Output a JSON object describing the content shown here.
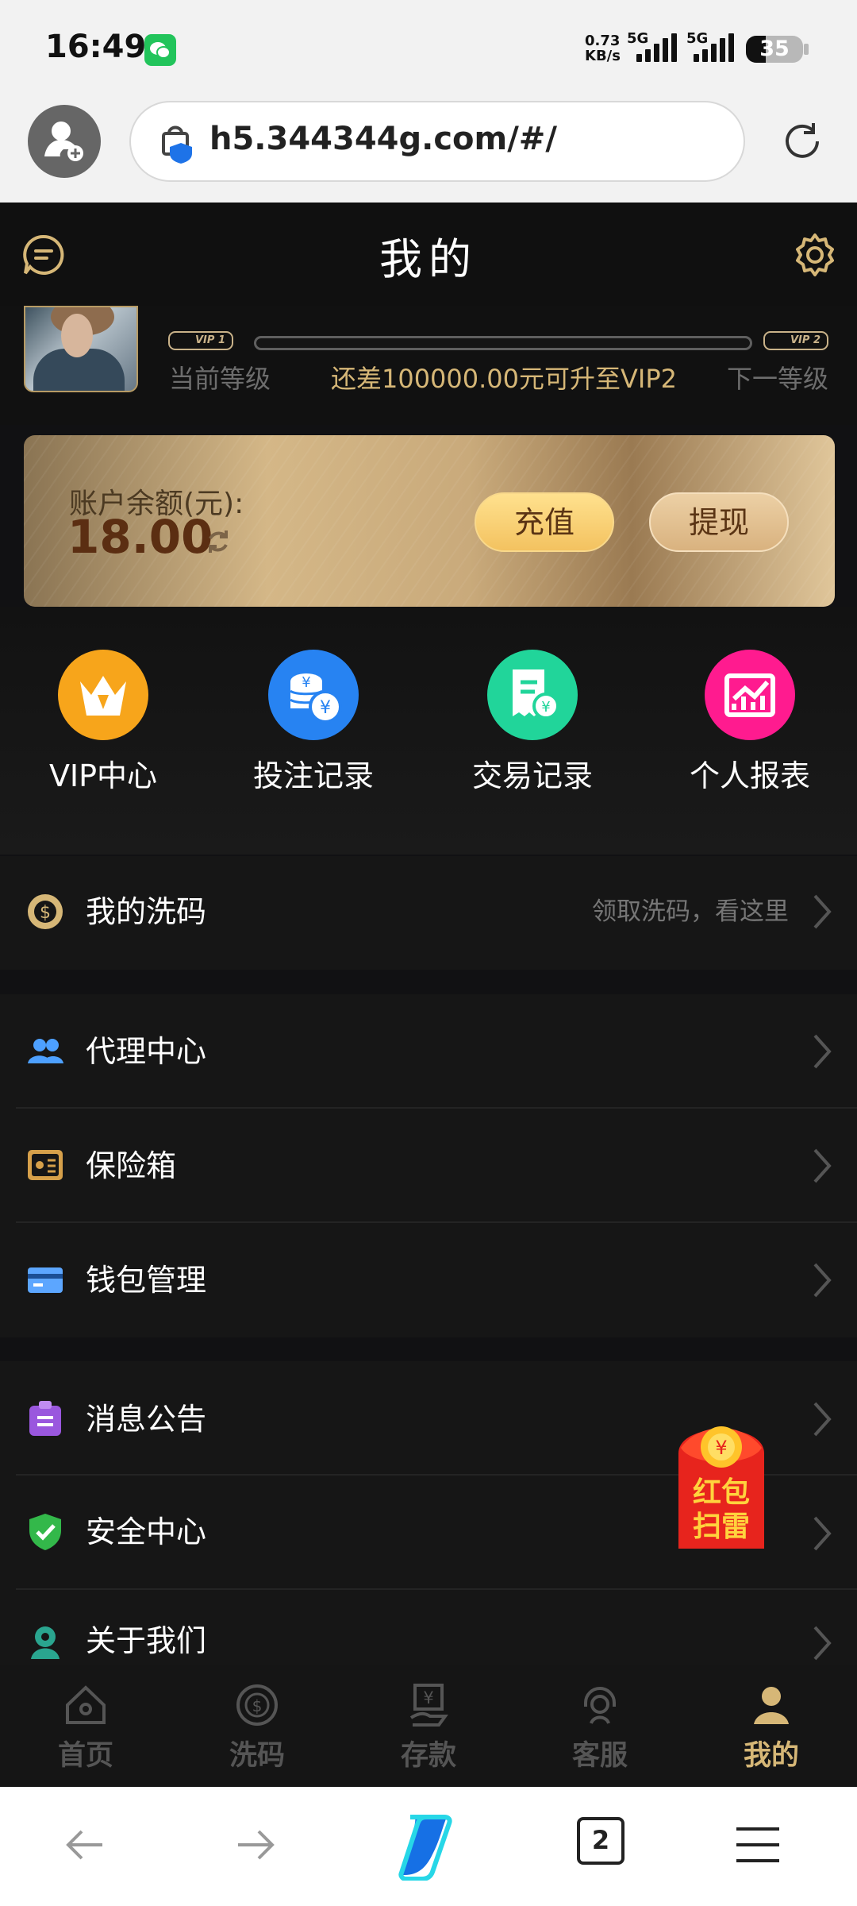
{
  "status_bar": {
    "time": "16:49",
    "network_speed_value": "0.73",
    "network_speed_unit": "KB/s",
    "signal_1": "5G",
    "signal_2": "5G",
    "battery": "35",
    "battery_level": 0.35
  },
  "browser": {
    "url": "h5.344344g.com/#/",
    "tab_count": "2"
  },
  "header": {
    "title": "我的"
  },
  "profile": {
    "current_vip": "VIP 1",
    "next_vip": "VIP 2",
    "current_level_label": "当前等级",
    "upgrade_text": "还差100000.00元可升至VIP2",
    "next_level_label": "下一等级",
    "vip_progress": 0
  },
  "balance": {
    "label": "账户余额(元):",
    "value": "18.00",
    "recharge_label": "充值",
    "withdraw_label": "提现"
  },
  "quick_actions": [
    {
      "label": "VIP中心",
      "icon": "vip-crown-icon",
      "color": "#f7a51b"
    },
    {
      "label": "投注记录",
      "icon": "coins-stack-icon",
      "color": "#2783f2"
    },
    {
      "label": "交易记录",
      "icon": "receipt-icon",
      "color": "#21d59a"
    },
    {
      "label": "个人报表",
      "icon": "bar-chart-icon",
      "color": "#ff1b8f"
    }
  ],
  "menu": {
    "wash_code": {
      "label": "我的洗码",
      "hint": "领取洗码，看这里",
      "icon": "dollar-coin-icon"
    },
    "agent": {
      "label": "代理中心",
      "icon": "agent-users-icon"
    },
    "safe": {
      "label": "保险箱",
      "icon": "safe-box-icon"
    },
    "wallet": {
      "label": "钱包管理",
      "icon": "wallet-card-icon"
    },
    "notice": {
      "label": "消息公告",
      "icon": "notice-board-icon"
    },
    "security": {
      "label": "安全中心",
      "icon": "shield-check-icon"
    },
    "about": {
      "label": "关于我们",
      "icon": "about-us-icon"
    }
  },
  "redpacket": {
    "line1": "红包",
    "line2": "扫雷"
  },
  "tabs": [
    {
      "label": "首页",
      "icon": "home-icon"
    },
    {
      "label": "洗码",
      "icon": "coin-tab-icon"
    },
    {
      "label": "存款",
      "icon": "deposit-icon"
    },
    {
      "label": "客服",
      "icon": "support-icon"
    },
    {
      "label": "我的",
      "icon": "user-icon"
    }
  ],
  "colors": {
    "accent": "#d6b777",
    "background": "#111113"
  }
}
